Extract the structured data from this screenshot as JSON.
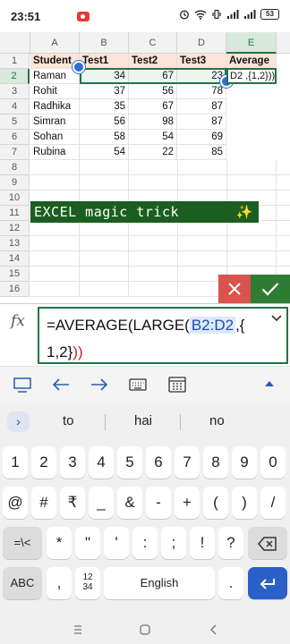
{
  "status": {
    "time": "23:51",
    "battery": "53"
  },
  "columns": [
    "A",
    "B",
    "C",
    "D",
    "E"
  ],
  "rows": [
    "1",
    "2",
    "3",
    "4",
    "5",
    "6",
    "7",
    "8",
    "9",
    "10",
    "11",
    "12",
    "13",
    "14",
    "15",
    "16"
  ],
  "table": {
    "headers": [
      "Student",
      "Test1",
      "Test2",
      "Test3",
      "Average"
    ],
    "data": [
      [
        "Raman",
        "34",
        "67",
        "23"
      ],
      [
        "Rohit",
        "37",
        "56",
        "78"
      ],
      [
        "Radhika",
        "35",
        "67",
        "87"
      ],
      [
        "Simran",
        "56",
        "98",
        "87"
      ],
      [
        "Sohan",
        "58",
        "54",
        "69"
      ],
      [
        "Rubina",
        "54",
        "22",
        "85"
      ]
    ],
    "e2_preview": "D2 ,{1,2}))"
  },
  "banner": {
    "text": "EXCEL magic trick",
    "icon": "wand-icon"
  },
  "formula": {
    "part1": "=AVERAGE(LARGE(",
    "ref": "B2:D2",
    "part2": ",{",
    "line2": "1,2}",
    "closing": "))"
  },
  "keyboard": {
    "suggestions": [
      "to",
      "hai",
      "no"
    ],
    "row1": [
      "1",
      "2",
      "3",
      "4",
      "5",
      "6",
      "7",
      "8",
      "9",
      "0"
    ],
    "row2": [
      "@",
      "#",
      "₹",
      "_",
      "&",
      "-",
      "+",
      "(",
      ")",
      "/"
    ],
    "row3": [
      "=\\<",
      "*",
      "\"",
      "'",
      ":",
      ";",
      "!",
      "?"
    ],
    "row4": {
      "abc": "ABC",
      "comma": ",",
      "frac_top": "12",
      "frac_bottom": "34",
      "space": "English",
      "period": "."
    }
  },
  "colors": {
    "accent": "#217346",
    "cancel": "#d9534f",
    "confirm": "#2e7d32",
    "enter": "#2c60c9",
    "header_fill": "#fce4d6"
  }
}
